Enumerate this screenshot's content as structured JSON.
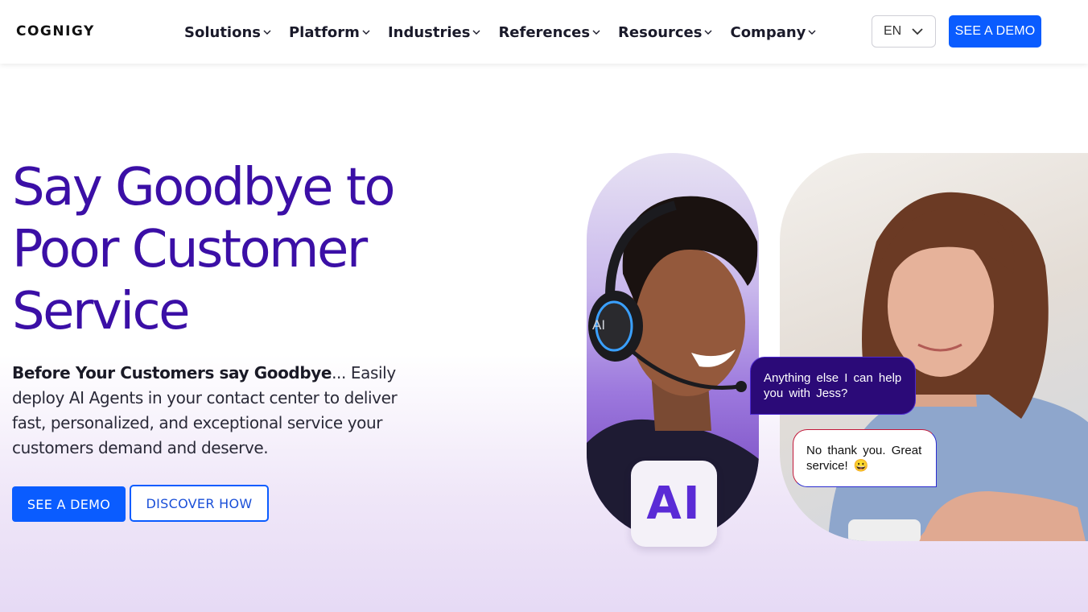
{
  "header": {
    "logo": "COGNIGY",
    "nav": [
      {
        "label": "Solutions"
      },
      {
        "label": "Platform"
      },
      {
        "label": "Industries"
      },
      {
        "label": "References"
      },
      {
        "label": "Resources"
      },
      {
        "label": "Company"
      }
    ],
    "language": "EN",
    "demo_button": "SEE A DEMO"
  },
  "hero": {
    "headline_line1": "Say Goodbye to",
    "headline_line2": "Poor Customer",
    "headline_line3": "Service",
    "sub_bold": "Before Your Customers say Goodbye",
    "sub_rest": "... Easily deploy AI Agents in your contact center to deliver fast, personalized, and exceptional service your customers demand and deserve.",
    "primary_cta": "SEE A DEMO",
    "secondary_cta": "DISCOVER HOW"
  },
  "imagery": {
    "ai_badge": "AI",
    "headset_badge": "AI",
    "agent_message": "Anything else I can help you with Jess?",
    "customer_message": "No thank you. Great service! 😀"
  },
  "colors": {
    "brand_blue": "#0a5cff",
    "headline_purple": "#3b0fa6",
    "bubble_dark": "#2b0a78"
  }
}
